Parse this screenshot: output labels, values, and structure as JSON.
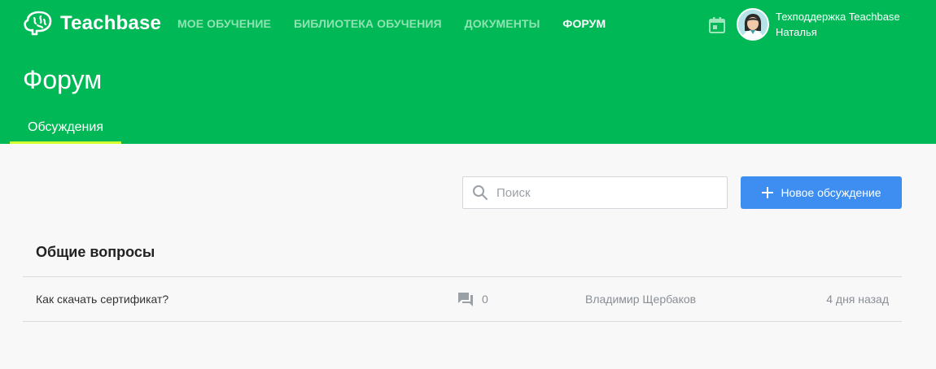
{
  "app": {
    "logo_text": "Teachbase"
  },
  "nav": {
    "items": [
      {
        "label": "МОЕ ОБУЧЕНИЕ",
        "active": false
      },
      {
        "label": "БИБЛИОТЕКА ОБУЧЕНИЯ",
        "active": false
      },
      {
        "label": "ДОКУМЕНТЫ",
        "active": false
      },
      {
        "label": "ФОРУМ",
        "active": true
      }
    ]
  },
  "user": {
    "name": "Техподдержка Teachbase",
    "subtitle": "Наталья"
  },
  "page": {
    "title": "Форум",
    "tab": "Обсуждения"
  },
  "toolbar": {
    "search_placeholder": "Поиск",
    "new_button_label": "Новое обсуждение"
  },
  "sections": [
    {
      "title": "Общие вопросы",
      "topics": [
        {
          "title": "Как скачать сертификат?",
          "comments": "0",
          "author": "Владимир Щербаков",
          "date": "4 дня назад"
        }
      ]
    }
  ],
  "colors": {
    "header_bg": "#00b956",
    "tab_underline": "#d6ff2e",
    "primary_button": "#3d8ef0"
  },
  "icons": [
    "brain-logo-icon",
    "calendar-icon",
    "avatar",
    "search-icon",
    "plus-icon",
    "comment-icon"
  ]
}
